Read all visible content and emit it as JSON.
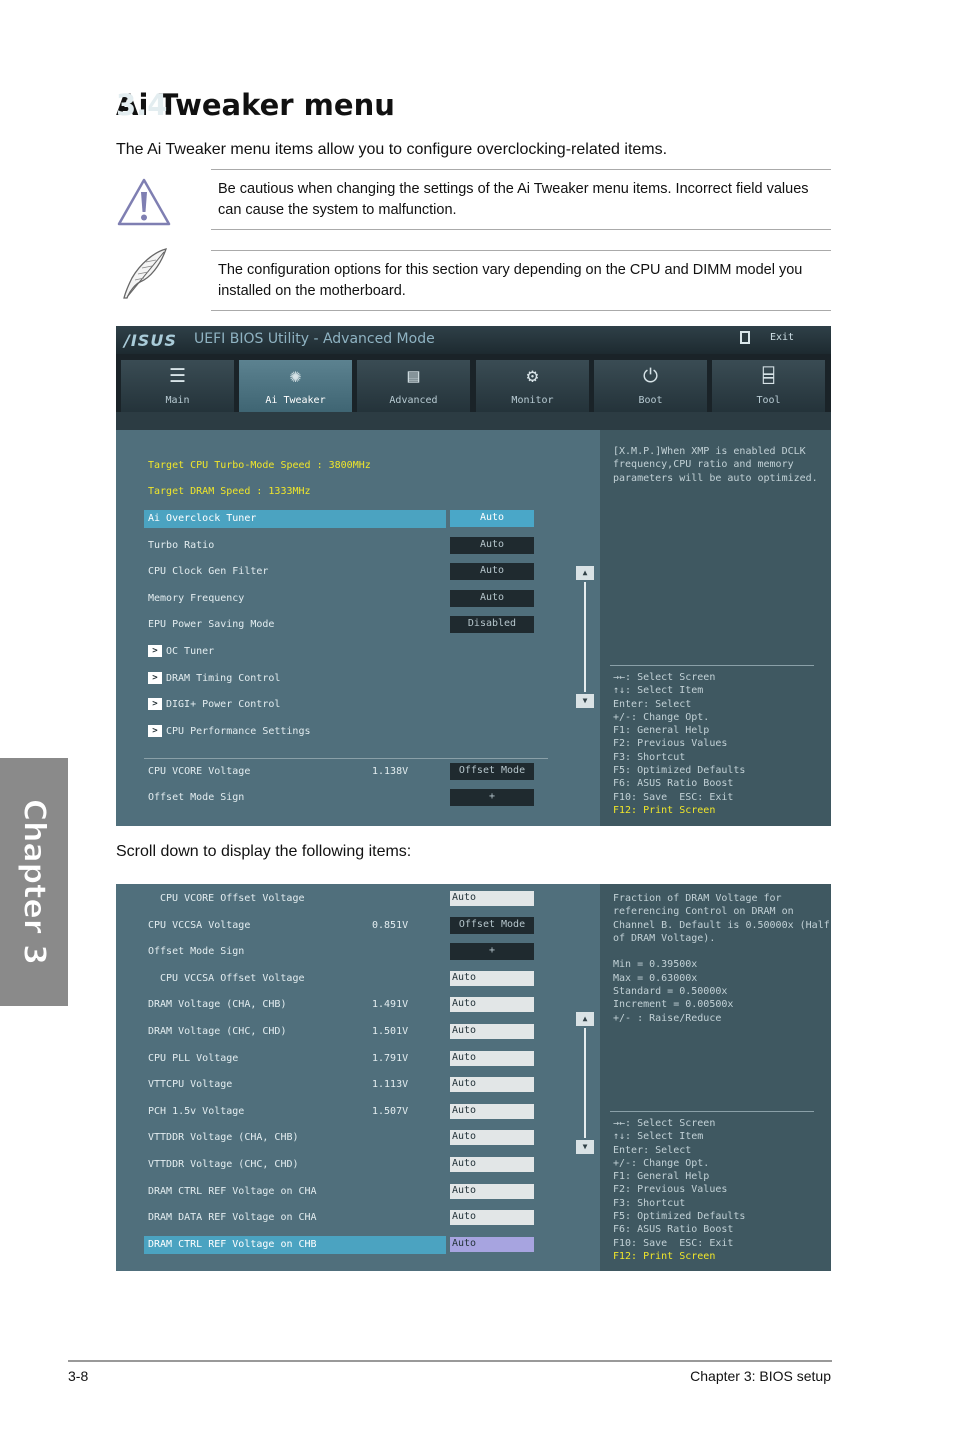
{
  "section": {
    "number": "3.4",
    "title": "Ai Tweaker menu"
  },
  "intro": "The Ai Tweaker menu items allow you to configure overclocking-related items.",
  "caution": "Be cautious when changing the settings of the Ai Tweaker menu items. Incorrect field values can cause the system to malfunction.",
  "note": "The configuration options for this section vary depending on the CPU and DIMM model you installed on the motherboard.",
  "chapter_tab": "Chapter 3",
  "scroll_text": "Scroll down to display the following items:",
  "footer": {
    "page": "3-8",
    "chapter": "Chapter 3: BIOS setup"
  },
  "icons": {
    "caution": "warning-triangle-icon",
    "note": "feather-pen-icon"
  },
  "bios1": {
    "logo": "/ISUS",
    "title": "UEFI BIOS Utility - Advanced Mode",
    "exit": "Exit",
    "tabs": [
      {
        "label": "Main",
        "icon": "list-icon"
      },
      {
        "label": "Ai Tweaker",
        "icon": "tweaker-icon"
      },
      {
        "label": "Advanced",
        "icon": "advanced-icon"
      },
      {
        "label": "Monitor",
        "icon": "monitor-icon"
      },
      {
        "label": "Boot",
        "icon": "power-icon"
      },
      {
        "label": "Tool",
        "icon": "tool-icon"
      }
    ],
    "target_cpu": "Target CPU Turbo-Mode Speed : 3800MHz",
    "target_dram": "Target DRAM Speed : 1333MHz",
    "items": [
      {
        "label": "Ai Overclock Tuner",
        "value": "Auto"
      },
      {
        "label": "Turbo Ratio",
        "value": "Auto"
      },
      {
        "label": "CPU Clock Gen Filter",
        "value": "Auto"
      },
      {
        "label": "Memory Frequency",
        "value": "Auto"
      },
      {
        "label": "EPU Power Saving Mode",
        "value": "Disabled"
      }
    ],
    "submenus": [
      "OC Tuner",
      "DRAM Timing Control",
      "DIGI+ Power Control",
      "CPU Performance Settings"
    ],
    "voltage_items": [
      {
        "label": "CPU VCORE Voltage",
        "reading": "1.138V",
        "value": "Offset Mode"
      },
      {
        "label": "Offset Mode Sign",
        "reading": "",
        "value": "+"
      }
    ],
    "help": "[X.M.P.]When XMP is enabled DCLK\nfrequency,CPU ratio and memory\nparameters will be auto optimized.",
    "keys": [
      "→←: Select Screen",
      "↑↓: Select Item",
      "Enter: Select",
      "+/-: Change Opt.",
      "F1: General Help",
      "F2: Previous Values",
      "F3: Shortcut",
      "F5: Optimized Defaults",
      "F6: ASUS Ratio Boost",
      "F10: Save  ESC: Exit"
    ],
    "key_highlight": "F12: Print Screen"
  },
  "bios2": {
    "items": [
      {
        "label": "CPU VCORE Offset Voltage",
        "reading": "",
        "value": "Auto",
        "indent": true
      },
      {
        "label": "CPU VCCSA Voltage",
        "reading": "0.851V",
        "value": "Offset Mode",
        "indent": false
      },
      {
        "label": "Offset Mode Sign",
        "reading": "",
        "value": "+",
        "indent": false
      },
      {
        "label": "CPU VCCSA Offset Voltage",
        "reading": "",
        "value": "Auto",
        "indent": true
      },
      {
        "label": "DRAM Voltage (CHA, CHB)",
        "reading": "1.491V",
        "value": "Auto",
        "indent": false
      },
      {
        "label": "DRAM Voltage (CHC, CHD)",
        "reading": "1.501V",
        "value": "Auto",
        "indent": false
      },
      {
        "label": "CPU PLL Voltage",
        "reading": "1.791V",
        "value": "Auto",
        "indent": false
      },
      {
        "label": "VTTCPU Voltage",
        "reading": "1.113V",
        "value": "Auto",
        "indent": false
      },
      {
        "label": "PCH 1.5v Voltage",
        "reading": "1.507V",
        "value": "Auto",
        "indent": false
      },
      {
        "label": "VTTDDR Voltage (CHA, CHB)",
        "reading": "",
        "value": "Auto",
        "indent": false
      },
      {
        "label": "VTTDDR Voltage (CHC, CHD)",
        "reading": "",
        "value": "Auto",
        "indent": false
      },
      {
        "label": "DRAM CTRL REF Voltage on CHA",
        "reading": "",
        "value": "Auto",
        "indent": false
      },
      {
        "label": "DRAM DATA REF Voltage on CHA",
        "reading": "",
        "value": "Auto",
        "indent": false
      },
      {
        "label": "DRAM CTRL REF Voltage on CHB",
        "reading": "",
        "value": "Auto",
        "indent": false
      }
    ],
    "help": "Fraction of DRAM Voltage for\nreferencing Control on DRAM on\nChannel B. Default is 0.50000x (Half\nof DRAM Voltage).\n\nMin = 0.39500x\nMax = 0.63000x\nStandard = 0.50000x\nIncrement = 0.00500x\n+/- : Raise/Reduce",
    "keys": [
      "→←: Select Screen",
      "↑↓: Select Item",
      "Enter: Select",
      "+/-: Change Opt.",
      "F1: General Help",
      "F2: Previous Values",
      "F3: Shortcut",
      "F5: Optimized Defaults",
      "F6: ASUS Ratio Boost",
      "F10: Save  ESC: Exit"
    ],
    "key_highlight": "F12: Print Screen"
  }
}
